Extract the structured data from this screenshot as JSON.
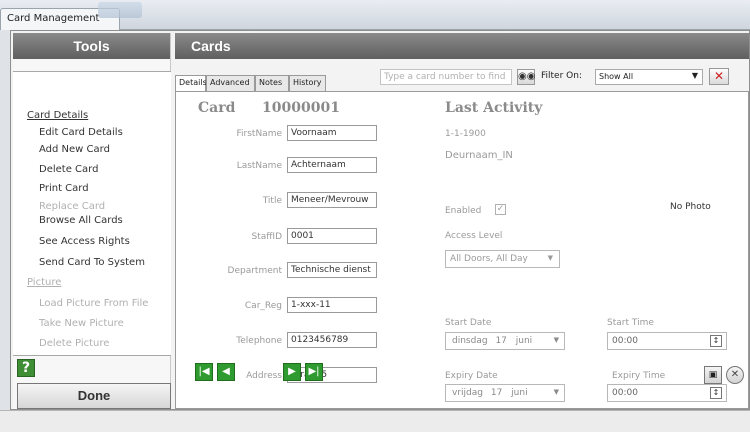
{
  "window": {
    "title": "Card Management"
  },
  "tools": {
    "header": "Tools",
    "sections": [
      {
        "label": "Card Details",
        "disabled": false
      },
      {
        "label": "Picture",
        "disabled": true
      }
    ],
    "items": [
      {
        "label": "Edit Card Details",
        "disabled": false
      },
      {
        "label": "Add New Card",
        "disabled": false
      },
      {
        "label": "Delete Card",
        "disabled": false
      },
      {
        "label": "Print Card",
        "disabled": false
      },
      {
        "label": "Replace Card",
        "disabled": true
      },
      {
        "label": "Browse All Cards",
        "disabled": false
      },
      {
        "label": "See Access Rights",
        "disabled": false
      },
      {
        "label": "Send Card To System",
        "disabled": false
      },
      {
        "label": "Load Picture From File",
        "disabled": true
      },
      {
        "label": "Take New Picture",
        "disabled": true
      },
      {
        "label": "Delete Picture",
        "disabled": true
      }
    ],
    "help_label": "?",
    "done_label": "Done"
  },
  "cards": {
    "header": "Cards",
    "tabs": [
      "Details",
      "Advanced",
      "Notes",
      "History"
    ],
    "active_tab": "Details",
    "search_placeholder": "Type a card number to find",
    "filter_label": "Filter On:",
    "filter_value": "Show All",
    "card_label": "Card",
    "card_number": "10000001",
    "fields": [
      {
        "label": "FirstName",
        "value": "Voornaam"
      },
      {
        "label": "LastName",
        "value": "Achternaam"
      },
      {
        "label": "Title",
        "value": "Meneer/Mevrouw"
      },
      {
        "label": "StaffID",
        "value": "0001"
      },
      {
        "label": "Department",
        "value": "Technische dienst"
      },
      {
        "label": "Car_Reg",
        "value": "1-xxx-11"
      },
      {
        "label": "Telephone",
        "value": "0123456789"
      },
      {
        "label": "Address",
        "value": "Straat 5"
      }
    ],
    "last_activity": {
      "title": "Last Activity",
      "date": "1-1-1900",
      "location": "Deurnaam_IN"
    },
    "enabled_label": "Enabled",
    "enabled_checked": true,
    "access_level_label": "Access Level",
    "access_level_value": "All Doors, All Day",
    "start_date_label": "Start Date",
    "start_date": {
      "day": "dinsdag",
      "num": "17",
      "month": "juni"
    },
    "start_time_label": "Start Time",
    "start_time": "00:00",
    "expiry_date_label": "Expiry Date",
    "expiry_date": {
      "day": "vrijdag",
      "num": "17",
      "month": "juni"
    },
    "expiry_time_label": "Expiry Time",
    "expiry_time": "00:00",
    "no_photo": "No Photo"
  },
  "colors": {
    "header_bg": "#6b6b6b",
    "nav_green": "#2f9a2f",
    "clear_red": "#d02020"
  }
}
